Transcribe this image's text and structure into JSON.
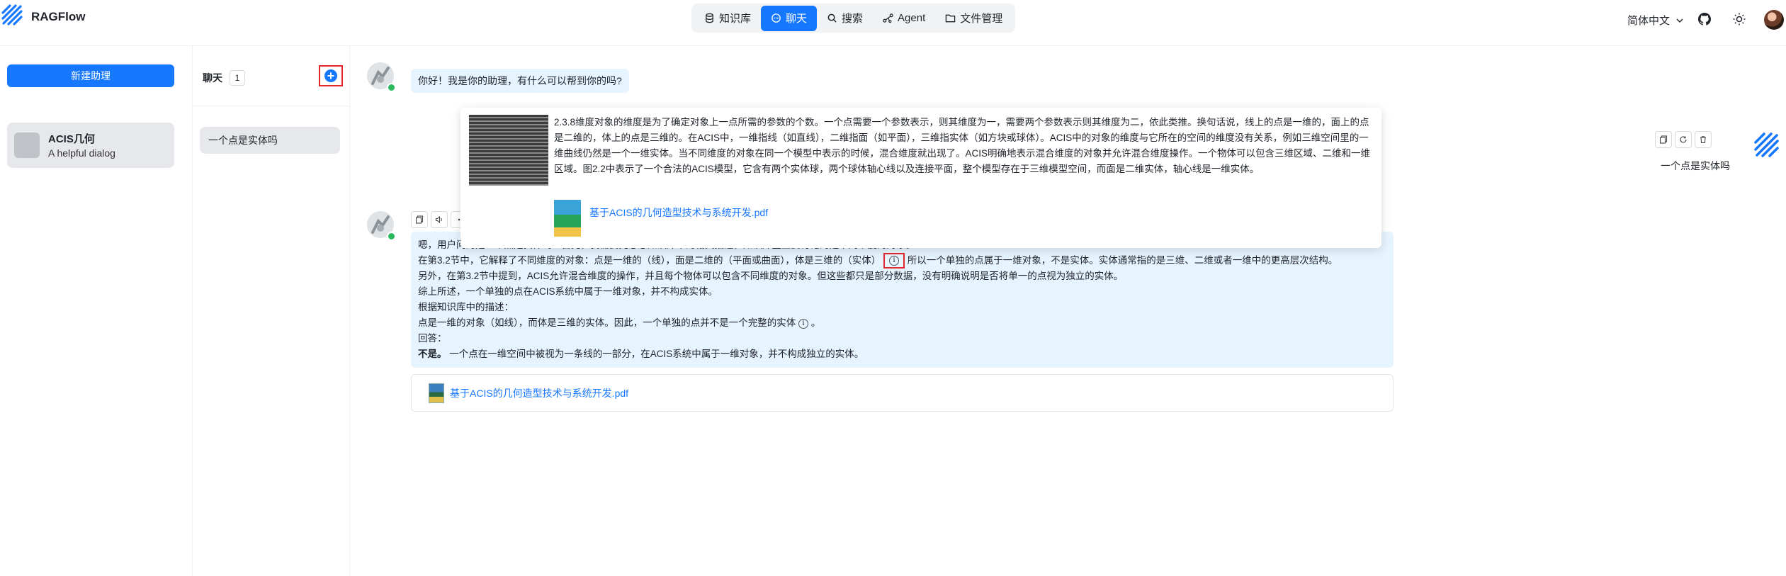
{
  "header": {
    "app_title": "RAGFlow",
    "nav": [
      {
        "label": "知识库",
        "icon": "database-icon",
        "active": false
      },
      {
        "label": "聊天",
        "icon": "chat-icon",
        "active": true
      },
      {
        "label": "搜索",
        "icon": "search-icon",
        "active": false
      },
      {
        "label": "Agent",
        "icon": "agent-icon",
        "active": false
      },
      {
        "label": "文件管理",
        "icon": "folder-icon",
        "active": false
      }
    ],
    "language": "简体中文",
    "accent_color": "#1677ff"
  },
  "sidebar": {
    "new_assistant_label": "新建助理",
    "assistant": {
      "name": "ACIS几何",
      "description": "A helpful dialog"
    }
  },
  "conversations": {
    "title": "聊天",
    "count": "1",
    "items": [
      {
        "label": "一个点是实体吗"
      }
    ]
  },
  "chat": {
    "greeting": "你好！我是你的助理，有什么可以帮到你的吗?",
    "answer_lines": [
      "嗯，用户问的是一个点是实体吗？首先，我需要先想想知识库中的相关描述，知识库里主要讨论的是不同维度的对象。",
      "在第3.2节中，它解释了不同维度的对象：点是一维的（线），面是二维的（平面或曲面），体是三维的（实体）",
      "所以一个单独的点属于一维对象，不是实体。实体通常指的是三维、二维或者一维中的更高层次结构。",
      "另外，在第3.2节中提到，ACIS允许混合维度的操作，并且每个物体可以包含不同维度的对象。但这些都只是部分数据，没有明确说明是否将单一的点视为独立的实体。",
      "综上所述，一个单独的点在ACIS系统中属于一维对象，并不构成实体。",
      "根据知识库中的描述：",
      "点是一维的对象（如线），而体是三维的实体。因此，一个单独的点并不是一个完整的实体",
      "。",
      "回答：",
      "不是。",
      "一个点在一维空间中被视为一条线的一部分，在ACIS系统中属于一维对象，并不构成独立的实体。"
    ],
    "document": "基于ACIS的几何造型技术与系统开发.pdf",
    "citation_icon": "info-icon"
  },
  "popover": {
    "text": "2.3.8维度对象的维度是为了确定对象上一点所需的参数的个数。一个点需要一个参数表示，则其维度为一，需要两个参数表示则其维度为二，依此类推。换句话说，线上的点是一维的，面上的点是二维的，体上的点是三维的。在ACIS中，一维指线（如直线），二维指面（如平面），三维指实体（如方块或球体）。ACIS中的对象的维度与它所在的空间的维度没有关系，例如三维空间里的一维曲线仍然是一个一维实体。当不同维度的对象在同一个模型中表示的时候，混合维度就出现了。ACIS明确地表示混合维度的对象并允许混合维度操作。一个物体可以包含三维区域、二维和一维区域。图2.2中表示了一个合法的ACIS模型，它含有两个实体球，两个球体轴心线以及连接平面，整个模型存在于三维模型空间，而面是二维实体，轴心线是一维实体。",
    "document": "基于ACIS的几何造型技术与系统开发.pdf"
  },
  "right_panel": {
    "question": "一个点是实体吗"
  }
}
